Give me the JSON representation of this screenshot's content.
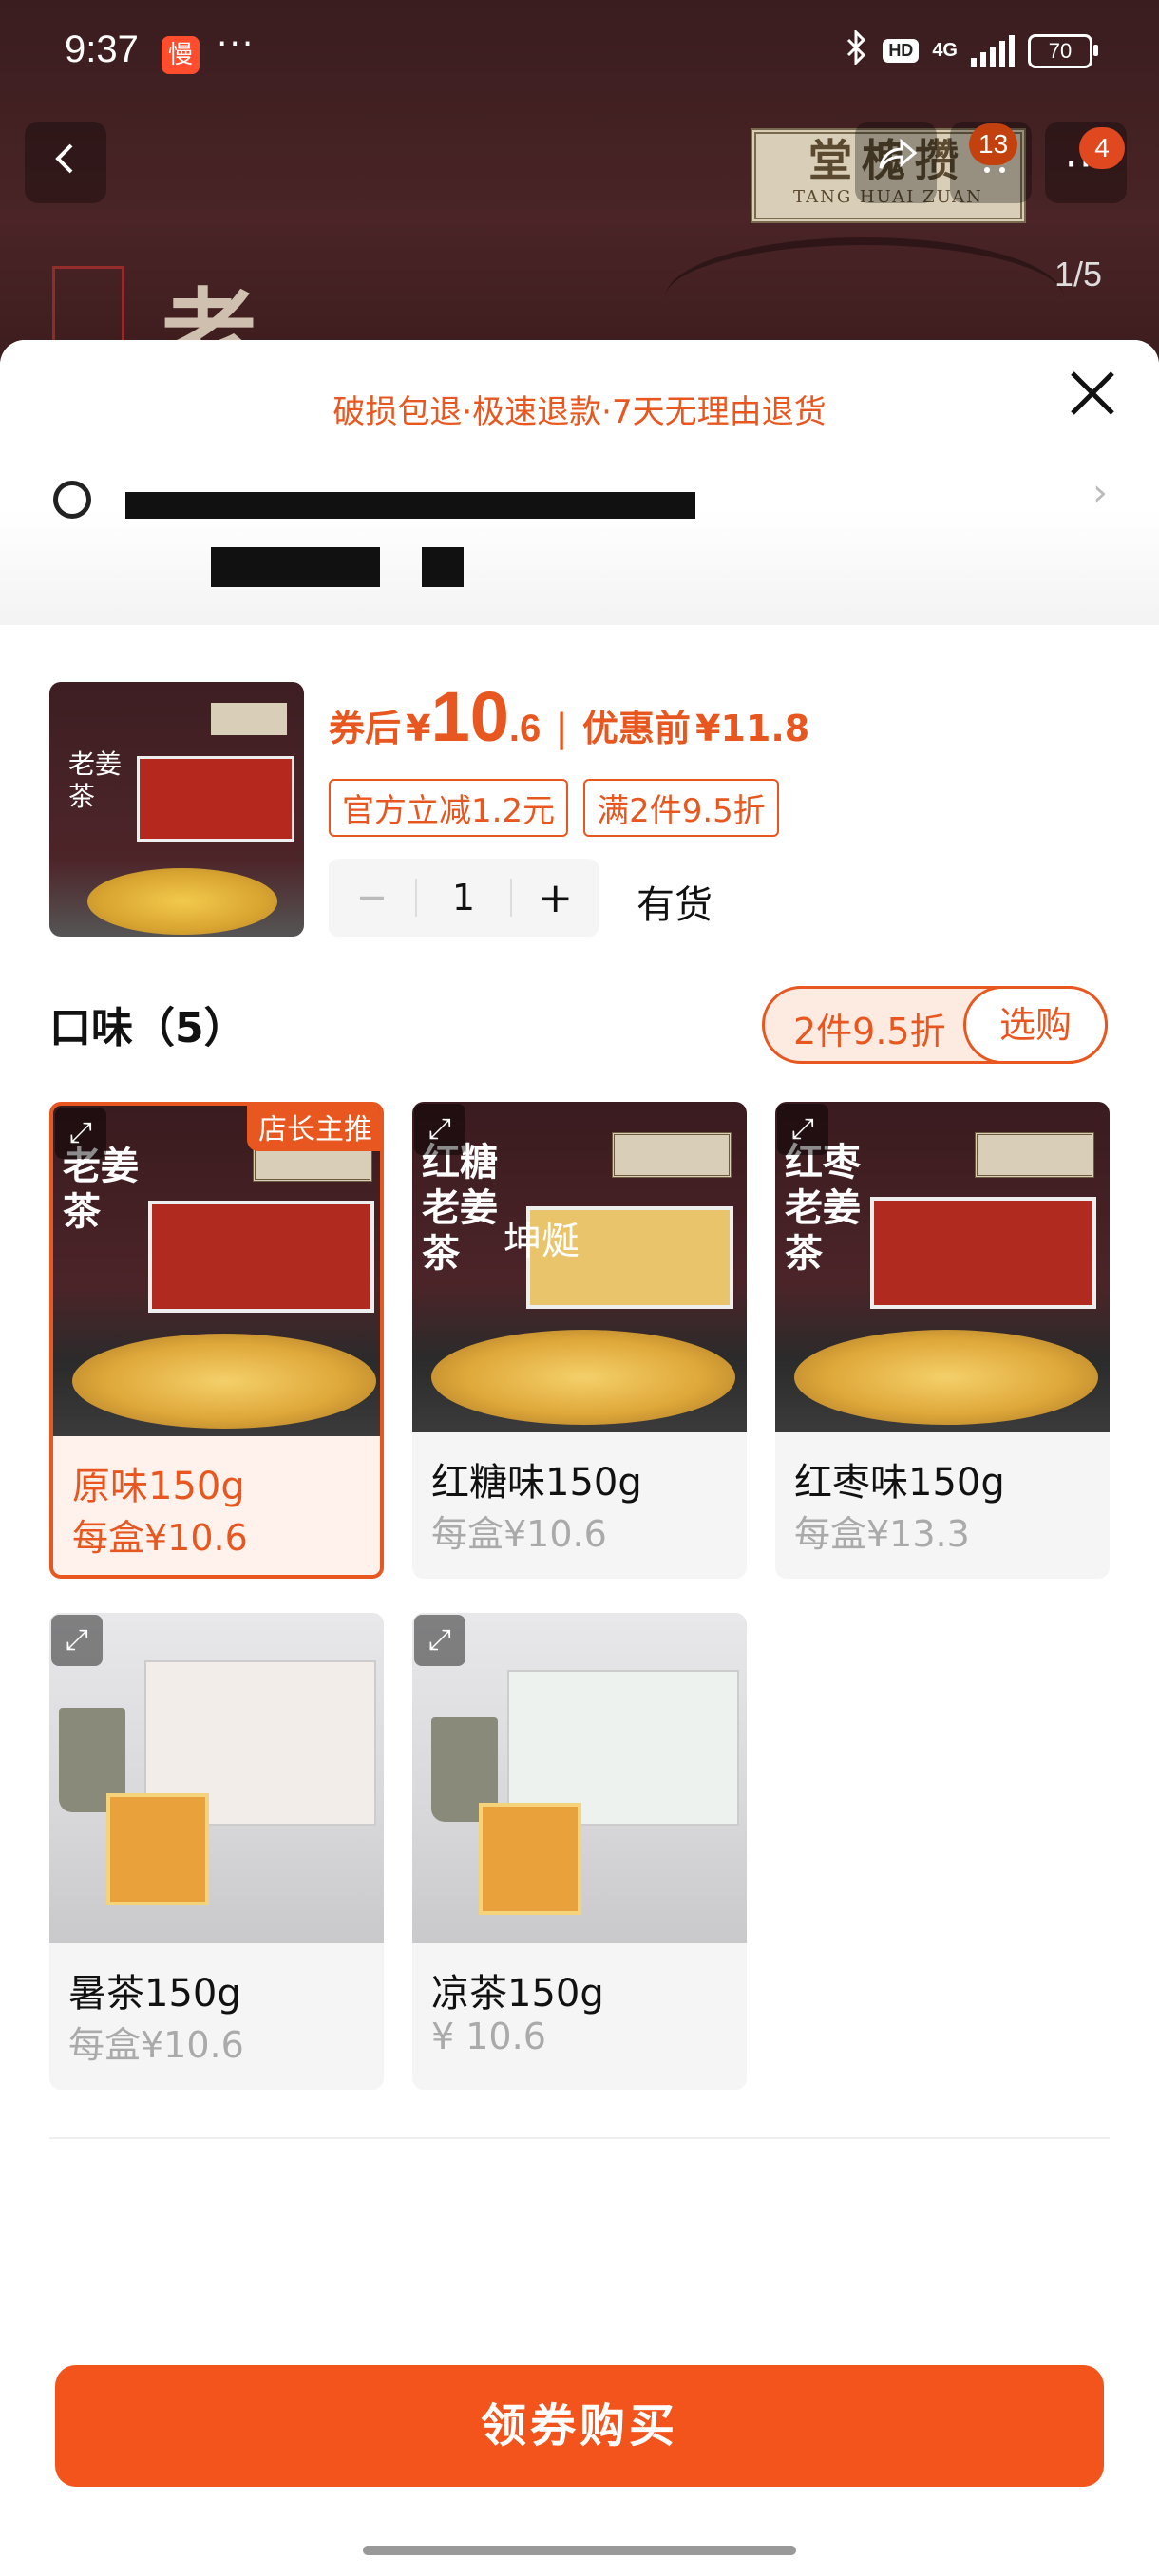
{
  "status_bar": {
    "time": "9:37",
    "app_badge": "慢",
    "dots": "···",
    "hd": "HD",
    "network": "4G",
    "battery": "70"
  },
  "header": {
    "page_indicator": "1/5",
    "cart_count": "13",
    "more_count": "4",
    "logo_main": "堂槐攒",
    "logo_sub": "TANG HUAI ZUAN",
    "hero_char": "老"
  },
  "sheet": {
    "service_text": "破损包退·极速退款·7天无理由退货"
  },
  "product": {
    "price_prefix": "券后",
    "currency": "¥",
    "price_int": "10",
    "price_dec": ".6",
    "pre_label": "优惠前",
    "pre_price": "¥11.8",
    "coupons": [
      "官方立减1.2元",
      "满2件9.5折"
    ],
    "qty_minus": "−",
    "qty": "1",
    "qty_plus": "+",
    "stock": "有货",
    "thumb_text": "老姜茶"
  },
  "flavors": {
    "title": "口味（5）",
    "promo_text": "2件9.5折",
    "promo_button": "选购",
    "hot_tag": "店长主推",
    "items": [
      {
        "name": "原味150g",
        "price": "每盒¥10.6",
        "img_text": "老姜茶"
      },
      {
        "name": "红糖味150g",
        "price": "每盒¥10.6",
        "img_text": "红糖老姜茶",
        "overlay": "坤烻"
      },
      {
        "name": "红枣味150g",
        "price": "每盒¥13.3",
        "img_text": "红枣老姜茶"
      },
      {
        "name": "暑茶150g",
        "price": "每盒¥10.6"
      },
      {
        "name": "凉茶150g",
        "price": "¥ 10.6"
      }
    ]
  },
  "footer": {
    "buy_label": "领券购买"
  },
  "colors": {
    "accent": "#e8571f",
    "buy_button": "#f2541b"
  }
}
